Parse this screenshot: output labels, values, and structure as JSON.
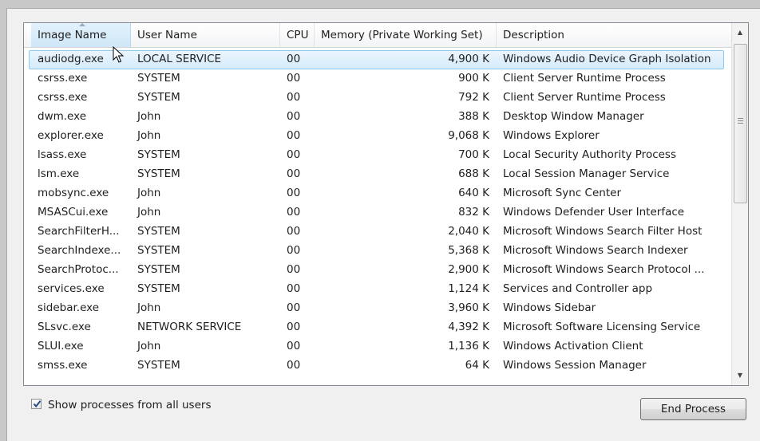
{
  "columns": [
    "Image Name",
    "User Name",
    "CPU",
    "Memory (Private Working Set)",
    "Description"
  ],
  "rows": [
    {
      "name": "audiodg.exe",
      "user": "LOCAL SERVICE",
      "cpu": "00",
      "mem": "4,900 K",
      "desc": "Windows Audio Device Graph Isolation"
    },
    {
      "name": "csrss.exe",
      "user": "SYSTEM",
      "cpu": "00",
      "mem": "900 K",
      "desc": "Client Server Runtime Process"
    },
    {
      "name": "csrss.exe",
      "user": "SYSTEM",
      "cpu": "00",
      "mem": "792 K",
      "desc": "Client Server Runtime Process"
    },
    {
      "name": "dwm.exe",
      "user": "John",
      "cpu": "00",
      "mem": "388 K",
      "desc": "Desktop Window Manager"
    },
    {
      "name": "explorer.exe",
      "user": "John",
      "cpu": "00",
      "mem": "9,068 K",
      "desc": "Windows Explorer"
    },
    {
      "name": "lsass.exe",
      "user": "SYSTEM",
      "cpu": "00",
      "mem": "700 K",
      "desc": "Local Security Authority Process"
    },
    {
      "name": "lsm.exe",
      "user": "SYSTEM",
      "cpu": "00",
      "mem": "688 K",
      "desc": "Local Session Manager Service"
    },
    {
      "name": "mobsync.exe",
      "user": "John",
      "cpu": "00",
      "mem": "640 K",
      "desc": "Microsoft Sync Center"
    },
    {
      "name": "MSASCui.exe",
      "user": "John",
      "cpu": "00",
      "mem": "832 K",
      "desc": "Windows Defender User Interface"
    },
    {
      "name": "SearchFilterH...",
      "user": "SYSTEM",
      "cpu": "00",
      "mem": "2,040 K",
      "desc": "Microsoft Windows Search Filter Host"
    },
    {
      "name": "SearchIndexe...",
      "user": "SYSTEM",
      "cpu": "00",
      "mem": "5,368 K",
      "desc": "Microsoft Windows Search Indexer"
    },
    {
      "name": "SearchProtoc...",
      "user": "SYSTEM",
      "cpu": "00",
      "mem": "2,900 K",
      "desc": "Microsoft Windows Search Protocol ..."
    },
    {
      "name": "services.exe",
      "user": "SYSTEM",
      "cpu": "00",
      "mem": "1,124 K",
      "desc": "Services and Controller app"
    },
    {
      "name": "sidebar.exe",
      "user": "John",
      "cpu": "00",
      "mem": "3,960 K",
      "desc": "Windows Sidebar"
    },
    {
      "name": "SLsvc.exe",
      "user": "NETWORK SERVICE",
      "cpu": "00",
      "mem": "4,392 K",
      "desc": "Microsoft Software Licensing Service"
    },
    {
      "name": "SLUI.exe",
      "user": "John",
      "cpu": "00",
      "mem": "1,136 K",
      "desc": "Windows Activation Client"
    },
    {
      "name": "smss.exe",
      "user": "SYSTEM",
      "cpu": "00",
      "mem": "64 K",
      "desc": "Windows Session Manager"
    }
  ],
  "selected_row": 0,
  "sorted_column": 0,
  "sort_direction": "ascending",
  "show_all_users": {
    "label": "Show processes from all users",
    "checked": true
  },
  "end_process_label": "End Process",
  "colors": {
    "selection_border": "#8ec9f0",
    "selection_fill": "#d6ecfb",
    "background": "#f0f0f0"
  }
}
